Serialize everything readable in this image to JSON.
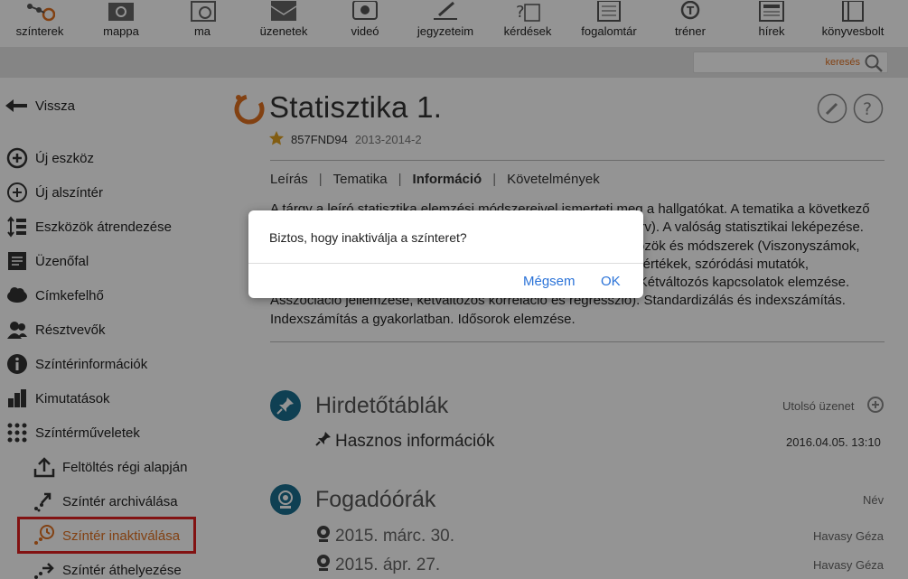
{
  "colors": {
    "accent": "#e07020",
    "teal": "#1a6f8f",
    "link": "#2b73d8",
    "highlight": "#e02020"
  },
  "toolbar": {
    "items": [
      {
        "label": "színterek",
        "icon": "network-icon"
      },
      {
        "label": "mappa",
        "icon": "folder-sync-icon"
      },
      {
        "label": "ma",
        "icon": "calendar-clock-icon"
      },
      {
        "label": "üzenetek",
        "icon": "envelope-icon"
      },
      {
        "label": "videó",
        "icon": "video-icon"
      },
      {
        "label": "jegyzeteim",
        "icon": "pen-lines-icon"
      },
      {
        "label": "kérdések",
        "icon": "question-doc-icon"
      },
      {
        "label": "fogalomtár",
        "icon": "list-doc-icon"
      },
      {
        "label": "tréner",
        "icon": "trainer-icon"
      },
      {
        "label": "hírek",
        "icon": "newspaper-icon"
      },
      {
        "label": "könyvesbolt",
        "icon": "book-icon"
      }
    ]
  },
  "search": {
    "placeholder": "keresés"
  },
  "sidebar": {
    "back": "Vissza",
    "items": [
      {
        "label": "Új eszköz",
        "icon": "add-circle-icon"
      },
      {
        "label": "Új alszíntér",
        "icon": "add-sub-icon"
      },
      {
        "label": "Eszközök átrendezése",
        "icon": "reorder-icon"
      },
      {
        "label": "Üzenőfal",
        "icon": "message-board-icon"
      },
      {
        "label": "Címkefelhő",
        "icon": "tag-cloud-icon"
      },
      {
        "label": "Résztvevők",
        "icon": "participants-icon"
      },
      {
        "label": "Színtérinformációk",
        "icon": "info-icon"
      },
      {
        "label": "Kimutatások",
        "icon": "bar-chart-icon"
      },
      {
        "label": "Színtérműveletek",
        "icon": "grid-dots-icon"
      }
    ],
    "subitems": [
      {
        "label": "Feltöltés régi alapján",
        "icon": "upload-icon"
      },
      {
        "label": "Színtér archiválása",
        "icon": "archive-icon"
      },
      {
        "label": "Színtér inaktiválása",
        "icon": "inactivate-clock-icon"
      },
      {
        "label": "Színtér áthelyezése",
        "icon": "move-arrow-icon"
      }
    ]
  },
  "course": {
    "title": "Statisztika 1.",
    "code": "857FND94",
    "term": "2013-2014-2"
  },
  "tabs": [
    "Leírás",
    "Tematika",
    "Információ",
    "Követelmények"
  ],
  "description": "A tárgy a leíró statisztika elemzési módszereivel ismerteti meg a hallgatókat.  A tematika a következő területeket tárgyalja: Statisztikai alapfogalmak (sokaság, ismérv). A valóság statisztikai leképezése. Statisztikai adatok és feldolgozásuk. Egyszerű elemzési eszközök és módszerek (Viszonyszámok, grafikus ábrázolás). Gyakorisági eloszlások jellemzése (középértékek, szóródási mutatók, alakmutatók, heterogén sokaságok elemzése, koncentráció). Kétváltozós kapcsolatok elemzése. Asszociáció jellemzése, kétváltozós korreláció és regresszió). Standardizálás és indexszámítás. Indexszámítás a gyakorlatban. Idősorok elemzése.",
  "sections": {
    "board": {
      "title": "Hirdetőtáblák",
      "note": "Utolsó üzenet",
      "entries": [
        {
          "title": "Hasznos információk",
          "date": "2016.04.05. 13:10"
        }
      ]
    },
    "office": {
      "title": "Fogadóórák",
      "note": "Név",
      "entries": [
        {
          "date": "2015. márc. 30.",
          "name": "Havasy Géza"
        },
        {
          "date": "2015. ápr. 27.",
          "name": "Havasy Géza"
        }
      ]
    }
  },
  "dialog": {
    "message": "Biztos, hogy inaktiválja a színteret?",
    "cancel": "Mégsem",
    "ok": "OK"
  }
}
